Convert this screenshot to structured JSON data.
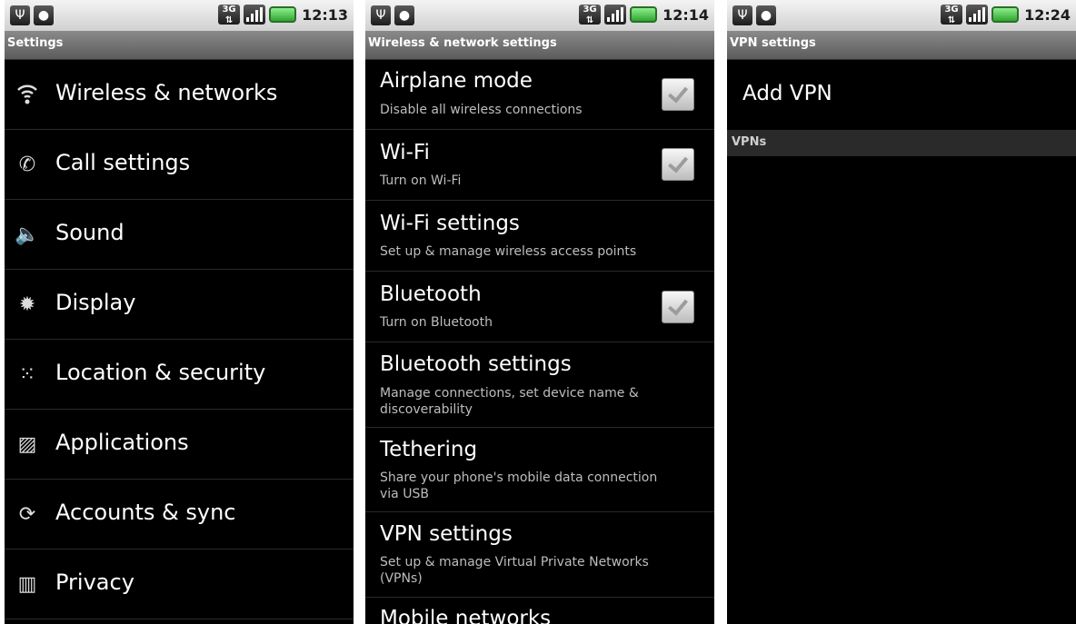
{
  "screens": [
    {
      "time": "12:13",
      "title": "Settings",
      "items": [
        {
          "label": "Wireless & networks",
          "icon": "wifi-icon"
        },
        {
          "label": "Call settings",
          "icon": "phone-icon"
        },
        {
          "label": "Sound",
          "icon": "speaker-icon"
        },
        {
          "label": "Display",
          "icon": "brightness-icon"
        },
        {
          "label": "Location & security",
          "icon": "grid-icon"
        },
        {
          "label": "Applications",
          "icon": "apps-icon"
        },
        {
          "label": "Accounts & sync",
          "icon": "sync-icon"
        },
        {
          "label": "Privacy",
          "icon": "privacy-icon"
        }
      ]
    },
    {
      "time": "12:14",
      "title": "Wireless & network settings",
      "items": [
        {
          "title": "Airplane mode",
          "summary": "Disable all wireless connections",
          "checkbox": true
        },
        {
          "title": "Wi-Fi",
          "summary": "Turn on Wi-Fi",
          "checkbox": true
        },
        {
          "title": "Wi-Fi settings",
          "summary": "Set up & manage wireless access points",
          "checkbox": false
        },
        {
          "title": "Bluetooth",
          "summary": "Turn on Bluetooth",
          "checkbox": true
        },
        {
          "title": "Bluetooth settings",
          "summary": "Manage connections, set device name & discoverability",
          "checkbox": false
        },
        {
          "title": "Tethering",
          "summary": "Share your phone's mobile data connection via USB",
          "checkbox": false
        },
        {
          "title": "VPN settings",
          "summary": "Set up & manage Virtual Private Networks (VPNs)",
          "checkbox": false
        },
        {
          "title": "Mobile networks",
          "summary": "",
          "checkbox": false
        }
      ]
    },
    {
      "time": "12:24",
      "title": "VPN settings",
      "add_label": "Add VPN",
      "section_header": "VPNs"
    }
  ]
}
